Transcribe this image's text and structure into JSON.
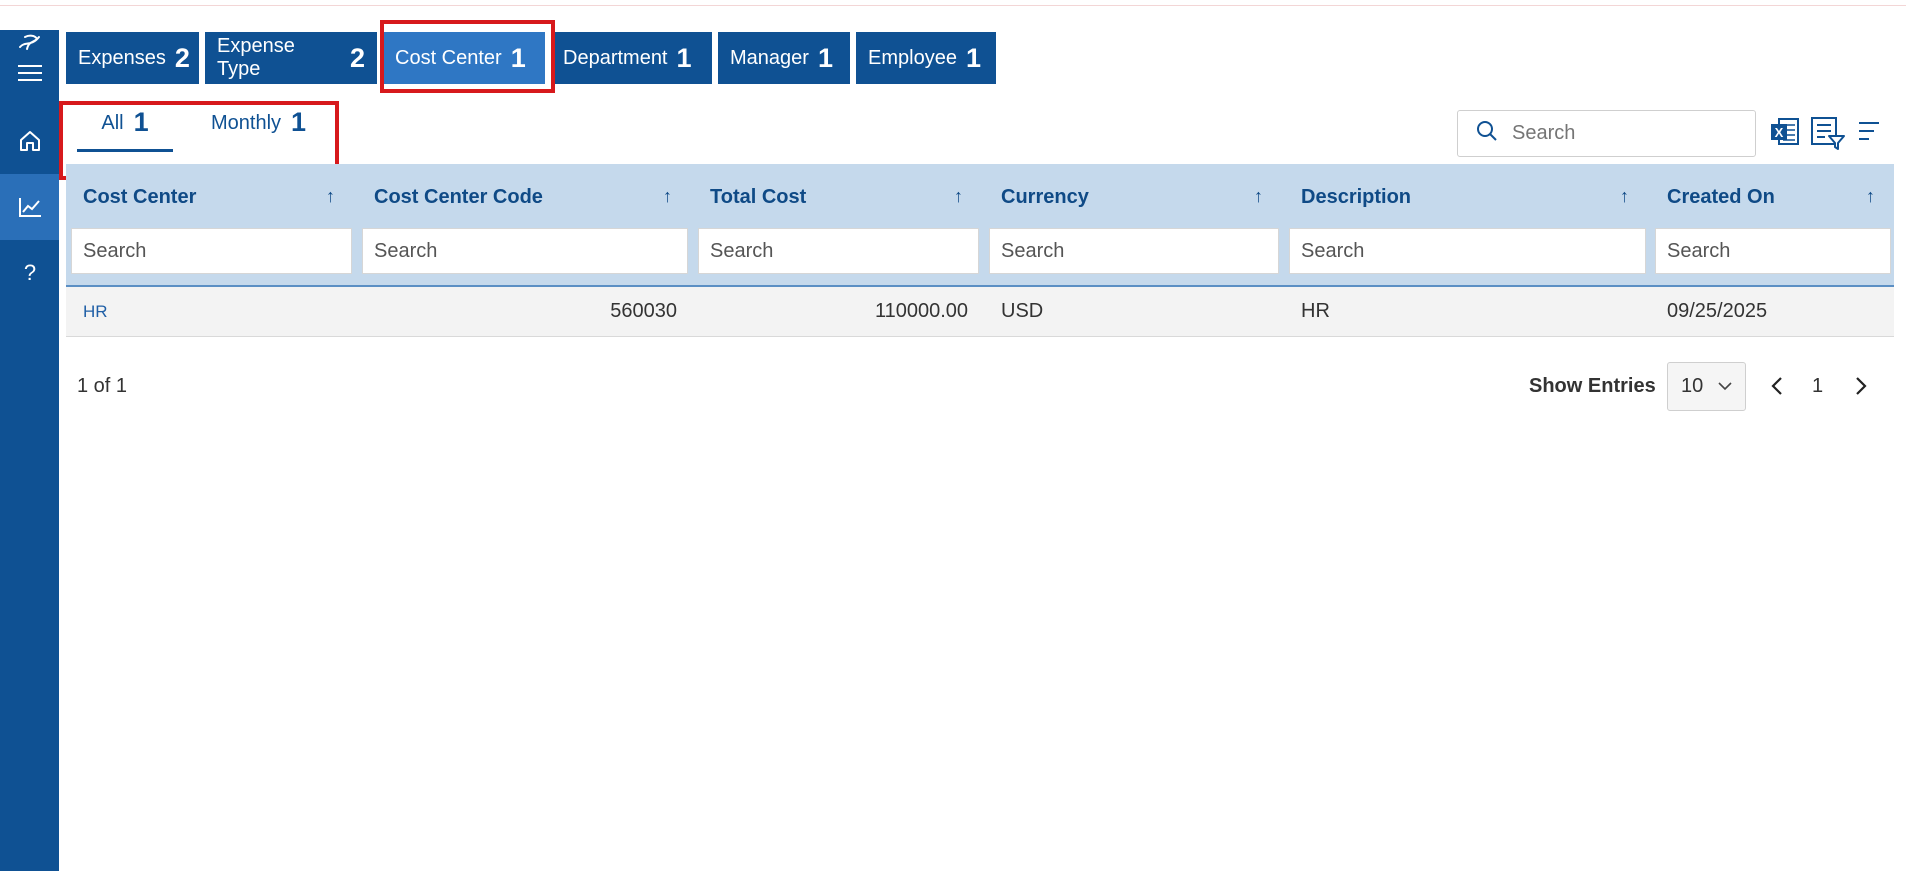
{
  "top_tabs": [
    {
      "label": "Expenses",
      "count": "2"
    },
    {
      "label": "Expense Type",
      "count": "2"
    },
    {
      "label": "Cost Center",
      "count": "1"
    },
    {
      "label": "Department",
      "count": "1"
    },
    {
      "label": "Manager",
      "count": "1"
    },
    {
      "label": "Employee",
      "count": "1"
    }
  ],
  "active_top_tab": "Cost Center",
  "sub_tabs": [
    {
      "label": "All",
      "count": "1"
    },
    {
      "label": "Monthly",
      "count": "1"
    }
  ],
  "active_sub_tab": "All",
  "search": {
    "placeholder": "Search"
  },
  "columns": [
    {
      "title": "Cost Center",
      "sort_icon": "↑",
      "filter_placeholder": "Search"
    },
    {
      "title": "Cost Center Code",
      "sort_icon": "↑",
      "filter_placeholder": "Search"
    },
    {
      "title": "Total Cost",
      "sort_icon": "↑",
      "filter_placeholder": "Search"
    },
    {
      "title": "Currency",
      "sort_icon": "↑",
      "filter_placeholder": "Search"
    },
    {
      "title": "Description",
      "sort_icon": "↑",
      "filter_placeholder": "Search"
    },
    {
      "title": "Created On",
      "sort_icon": "↑",
      "filter_placeholder": "Search"
    }
  ],
  "rows": [
    {
      "cost_center": "HR",
      "cost_center_code": "560030",
      "total_cost": "110000.00",
      "currency": "USD",
      "description": "HR",
      "created_on": "09/25/2025"
    }
  ],
  "pager": {
    "summary": "1 of 1",
    "show_entries_label": "Show Entries",
    "entries_value": "10",
    "current_page": "1"
  },
  "sidebar": {
    "items": [
      "logo-icon",
      "menu-icon",
      "home-icon",
      "chart-icon",
      "help-icon"
    ],
    "active": "chart-icon"
  },
  "icons": {
    "search": "search-icon",
    "excel_export": "excel-icon",
    "column_filter": "filter-list-icon",
    "column_chooser": "lines-icon"
  },
  "colors": {
    "sidebar": "#0f5193",
    "tab": "#0f5193",
    "active_tab": "#2f77c4",
    "header_bg": "#c5d9ec",
    "highlight": "#d7191c"
  }
}
